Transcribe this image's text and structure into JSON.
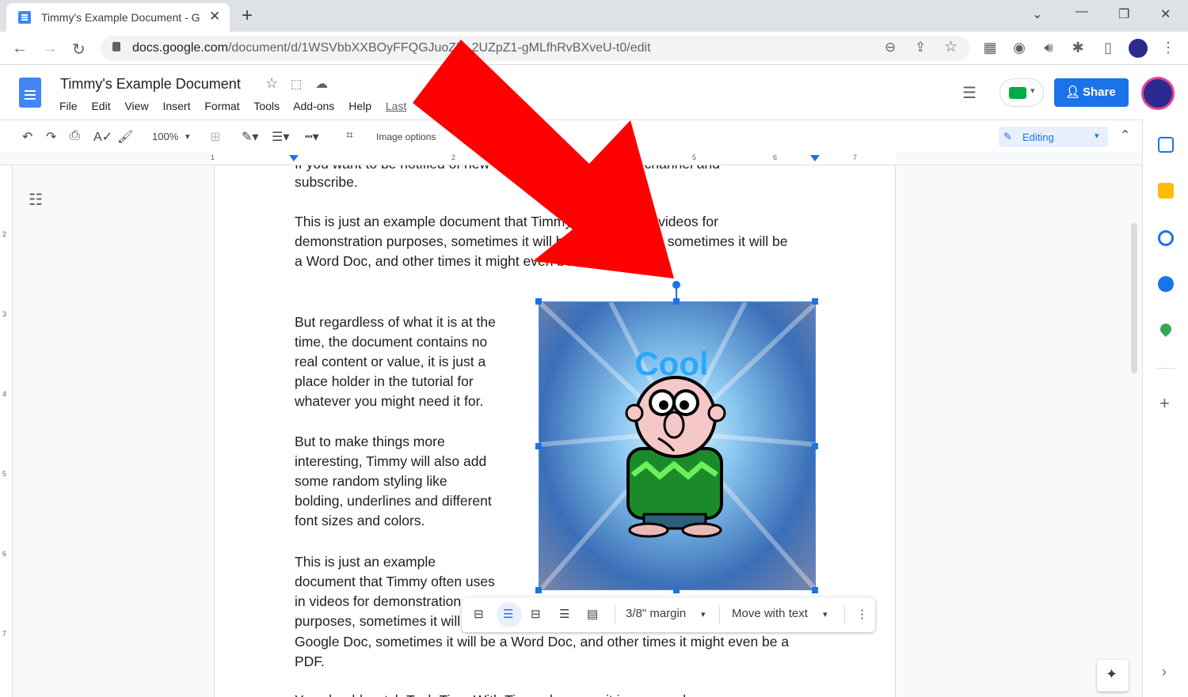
{
  "browser": {
    "tab_title": "Timmy's Example Document - Go",
    "url_host": "docs.google.com",
    "url_path": "/document/d/1WSVbbXXBOyFFQGJuoZY_2UZpZ1-gMLfhRvBXveU-t0/edit"
  },
  "docs": {
    "title": "Timmy's Example Document",
    "menus": [
      "File",
      "Edit",
      "View",
      "Insert",
      "Format",
      "Tools",
      "Add-ons",
      "Help",
      "Last"
    ],
    "share_label": "Share",
    "zoom": "100%",
    "image_options": "Image options",
    "mode": "Editing"
  },
  "ruler": [
    "1",
    "2",
    "5",
    "6",
    "7"
  ],
  "vruler": [
    "2",
    "3",
    "4",
    "5",
    "6",
    "7"
  ],
  "document": {
    "line_top_partial": "If you want to be notified of  new videos, visit my youtube channel and",
    "lines": [
      "subscribe.",
      "This is just an example document that Timmy often uses in videos for",
      "demonstration purposes, sometimes it will be a Google Doc, sometimes it will be",
      "a Word Doc, and other times it might even be a PDF."
    ],
    "wrap_paragraph_1": [
      "But regardless of what it is at the",
      "time, the document contains no",
      "real content or value, it is just a",
      "place holder in the tutorial for",
      "whatever you might need it for."
    ],
    "wrap_paragraph_2": [
      "But to make things more",
      "interesting, Timmy will also add",
      "some random styling like",
      "bolding, underlines and different",
      "font sizes and colors."
    ],
    "wrap_paragraph_3": [
      "This is just an example",
      "document that Timmy often uses",
      "in videos for demonstration",
      "purposes, sometimes it will be a"
    ],
    "full_lines": [
      "Google Doc, sometimes it will be a Word Doc, and other times it might even be a",
      "PDF."
    ],
    "bottom_partial": "You should watch Tech Time With Timmy because it is very cool"
  },
  "image": {
    "text": "Cool"
  },
  "image_toolbar": {
    "margin": "3/8\" margin",
    "position": "Move with text"
  },
  "colors": {
    "accent": "#1a73e8",
    "arrow": "#ff0000"
  }
}
